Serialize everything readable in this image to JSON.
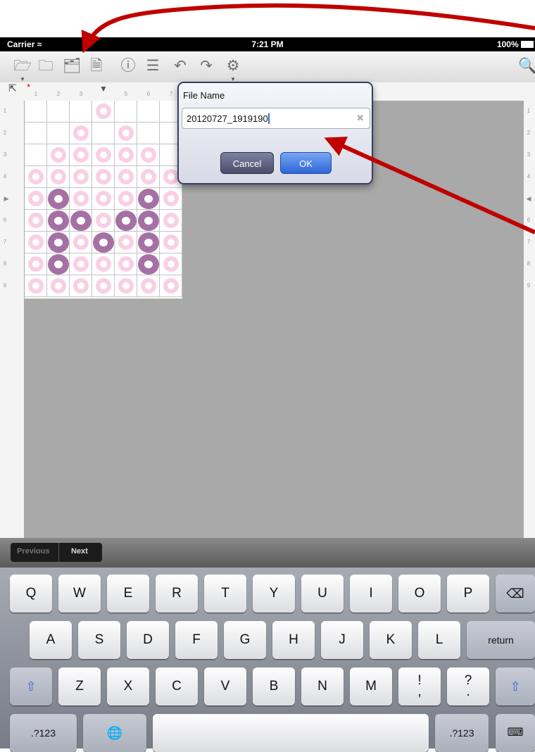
{
  "status_bar": {
    "carrier": "Carrier",
    "wifi_icon": "wifi-icon",
    "time": "7:21 PM",
    "battery": "100%"
  },
  "toolbar": {
    "icons": [
      "open-folder-icon",
      "save-folder-icon",
      "export-folder-icon",
      "pdf-icon",
      "info-icon",
      "list-icon",
      "undo-icon",
      "redo-icon",
      "gear-icon",
      "preview-icon"
    ]
  },
  "ruler": {
    "marker": "*",
    "columns": [
      "1",
      "2",
      "3",
      "",
      "5",
      "6",
      "7"
    ],
    "rows": [
      "1",
      "2",
      "3",
      "4",
      "",
      "6",
      "7",
      "8",
      "9"
    ],
    "rows_right": [
      "1",
      "2",
      "3",
      "4",
      "",
      "6",
      "7",
      "8",
      "9"
    ]
  },
  "pattern": {
    "rows": [
      "...p...",
      "..p.p..",
      ".ppppp.",
      "ppppppp",
      "pPpppPp",
      "pPPpPPp",
      "pPpPpPp",
      "pPpppPp",
      "ppppppp"
    ],
    "colors": {
      "pink": "#f9d0e3",
      "purple": "#a571a4"
    }
  },
  "dialog": {
    "title": "File Name",
    "filename": "20120727_1919190",
    "clear_icon": "✖",
    "cancel_label": "Cancel",
    "ok_label": "OK"
  },
  "form_nav": {
    "previous": "Previous",
    "next": "Next"
  },
  "keyboard": {
    "row1": [
      "Q",
      "W",
      "E",
      "R",
      "T",
      "Y",
      "U",
      "I",
      "O",
      "P"
    ],
    "row2": [
      "A",
      "S",
      "D",
      "F",
      "G",
      "H",
      "J",
      "K",
      "L"
    ],
    "row3": [
      "Z",
      "X",
      "C",
      "V",
      "B",
      "N",
      "M"
    ],
    "return_label": "return",
    "numbers_label": ".?123",
    "punct1": [
      "!",
      ","
    ],
    "punct2": [
      "?",
      "."
    ]
  },
  "annotation_color": "#c00000"
}
